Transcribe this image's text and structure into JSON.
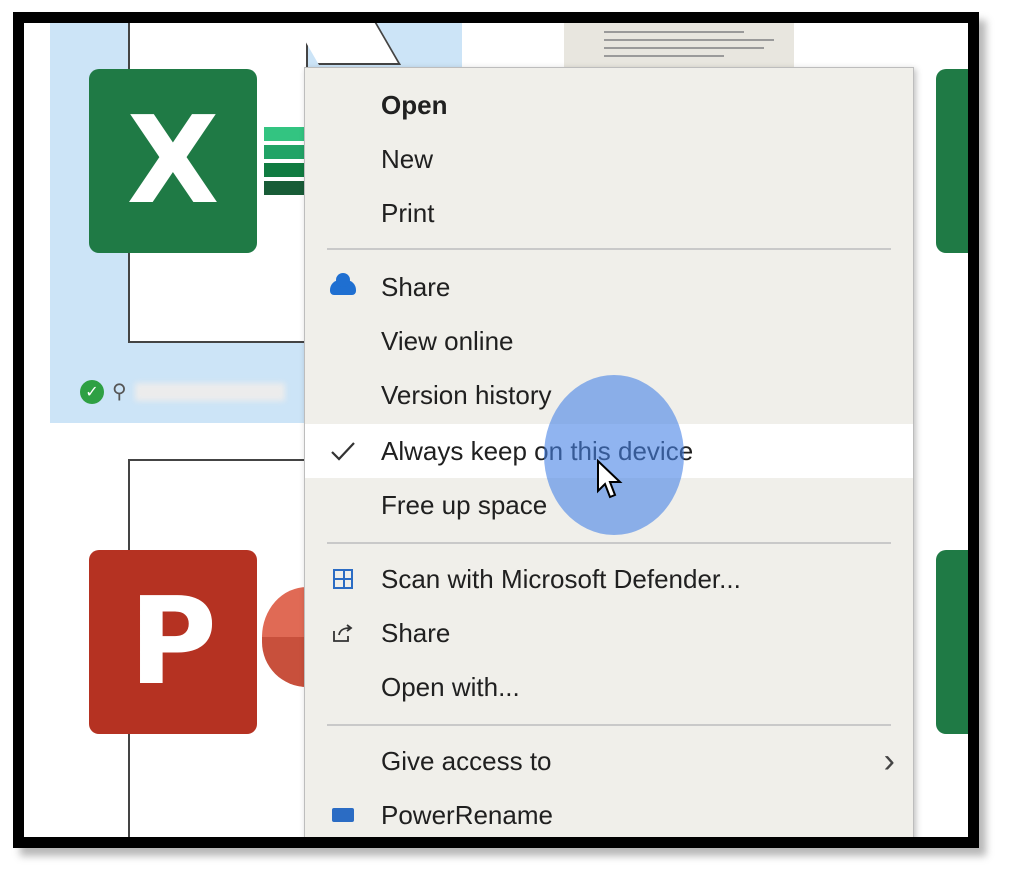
{
  "menu": {
    "items": [
      {
        "label": "Open",
        "icon": "",
        "bold": true
      },
      {
        "label": "New",
        "icon": ""
      },
      {
        "label": "Print",
        "icon": ""
      },
      {
        "label": "Share",
        "icon": "onedrive-cloud-icon"
      },
      {
        "label": "View online",
        "icon": ""
      },
      {
        "label": "Version history",
        "icon": ""
      },
      {
        "label": "Always keep on this device",
        "icon": "checkmark-icon",
        "checked": true,
        "hovered": true
      },
      {
        "label": "Free up space",
        "icon": ""
      },
      {
        "label": "Scan with Microsoft Defender...",
        "icon": "defender-icon"
      },
      {
        "label": "Share",
        "icon": "share-icon"
      },
      {
        "label": "Open with...",
        "icon": ""
      },
      {
        "label": "Give access to",
        "icon": "",
        "submenu": true
      },
      {
        "label": "PowerRename",
        "icon": "powerrename-icon"
      }
    ]
  },
  "files": {
    "excel_glyph": "X",
    "powerpoint_glyph": "P",
    "sync_status": "synced"
  },
  "colors": {
    "excel": "#1f7a45",
    "powerpoint": "#b53222",
    "onedrive": "#1f6fd1",
    "selection": "#cce4f7",
    "menu_bg": "#f0efea"
  }
}
